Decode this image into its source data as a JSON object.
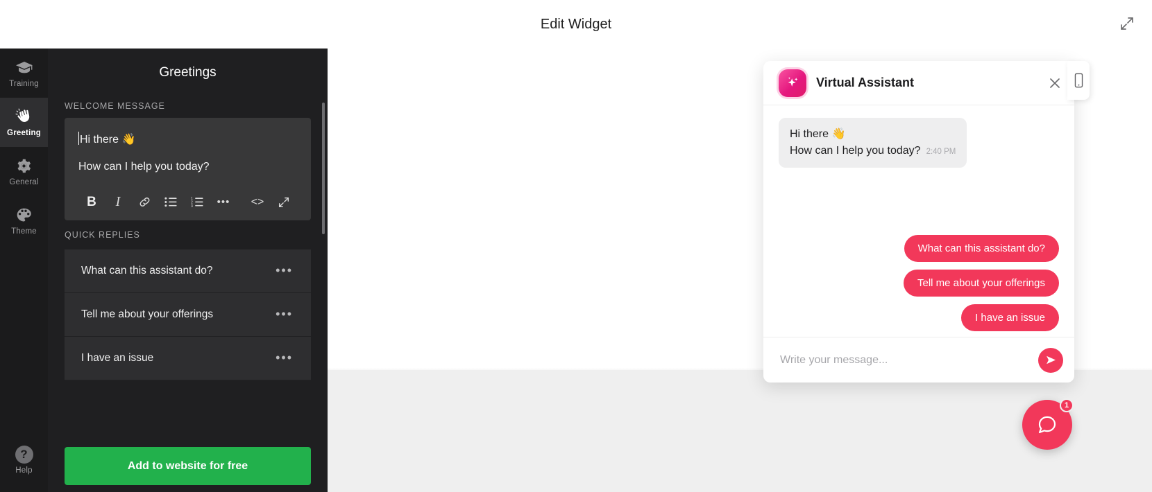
{
  "header": {
    "title": "Edit Widget",
    "expand_icon": "expand-arrows-icon"
  },
  "rail": {
    "items": [
      {
        "label": "Training",
        "icon": "graduation-cap-icon",
        "active": false
      },
      {
        "label": "Greeting",
        "icon": "waving-hand-icon",
        "active": true
      },
      {
        "label": "General",
        "icon": "gear-icon",
        "active": false
      },
      {
        "label": "Theme",
        "icon": "palette-icon",
        "active": false
      }
    ],
    "help": {
      "label": "Help",
      "glyph": "?"
    }
  },
  "panel": {
    "title": "Greetings",
    "welcome_section_label": "WELCOME MESSAGE",
    "welcome_message": {
      "line1": "Hi there 👋",
      "line2": "How can I help you today?"
    },
    "toolbar": [
      {
        "name": "bold-button",
        "label": "B"
      },
      {
        "name": "italic-button",
        "label": "I"
      },
      {
        "name": "link-icon",
        "label": ""
      },
      {
        "name": "bullet-list-icon",
        "label": ""
      },
      {
        "name": "numbered-list-icon",
        "label": ""
      },
      {
        "name": "more-options-button",
        "label": "•••"
      },
      {
        "name": "code-view-button",
        "label": "<>"
      },
      {
        "name": "fullscreen-editor-button",
        "label": ""
      }
    ],
    "quick_replies_label": "QUICK REPLIES",
    "quick_replies": [
      {
        "text": "What can this assistant do?",
        "menu": "•••"
      },
      {
        "text": "Tell me about your offerings",
        "menu": "•••"
      },
      {
        "text": "I have an issue",
        "menu": "•••"
      }
    ],
    "cta_label": "Add to website for free",
    "cta_color": "#22b14c"
  },
  "widget": {
    "name": "Virtual Assistant",
    "avatar_icon": "sparkle-icon",
    "close_icon": "close-icon",
    "accent_color": "#f2385a",
    "messages": [
      {
        "line1": "Hi there 👋",
        "line2": "How can I help you today?",
        "timestamp": "2:40 PM"
      }
    ],
    "quick_replies": [
      "What can this assistant do?",
      "Tell me about your offerings",
      "I have an issue"
    ],
    "input_placeholder": "Write your message...",
    "input_value": "",
    "send_icon": "send-icon",
    "device_toggle_icon": "mobile-phone-icon",
    "launcher": {
      "icon": "chat-bubble-icon",
      "badge": "1"
    }
  }
}
